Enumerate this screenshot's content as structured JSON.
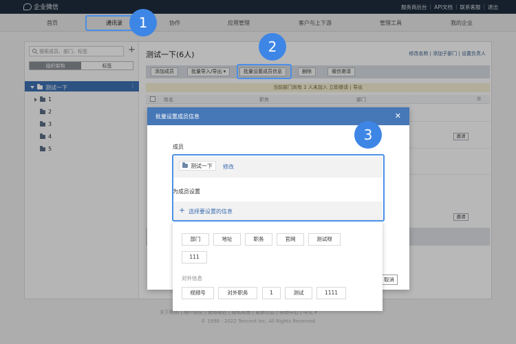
{
  "topbar": {
    "logo": "企业微信",
    "links": [
      "服务商后台",
      "API文档",
      "联系客服",
      "退出"
    ]
  },
  "nav": {
    "items": [
      "首页",
      "通讯录",
      "协作",
      "应用管理",
      "客户与上下游",
      "管理工具",
      "我的企业"
    ],
    "active": "通讯录"
  },
  "left": {
    "search_placeholder": "搜索成员、部门、标签",
    "plus": "+",
    "segments": [
      "组织架构",
      "标签"
    ],
    "root": "测试一下",
    "root_more": "⋮",
    "depts": [
      "1",
      "2",
      "3",
      "4",
      "5"
    ]
  },
  "main": {
    "title": "测试一下(6人)",
    "links": "修改名称 | 添加子部门 | 设置负责人",
    "toolbar": [
      "添加成员",
      "批量导入/导出 ▾",
      "批量设置成员信息",
      "删除",
      "微信邀请"
    ],
    "notice": "当前部门尚有 2 人未加入   立即邀请 | 导出",
    "columns": [
      "姓名",
      "职务",
      "部门"
    ],
    "invite": "邀请"
  },
  "modal": {
    "title": "批量设置成员信息",
    "close": "✕",
    "member_label": "成员",
    "member_chip": "测试一下",
    "member_edit": "修改",
    "settings_label": "为成员设置",
    "choose": "选择要设置的信息",
    "cancel": "取消"
  },
  "dropdown": {
    "basic": [
      "部门",
      "地址",
      "职务",
      "官网",
      "测试呀",
      "111"
    ],
    "external_label": "对外信息",
    "external": [
      "视频号",
      "对外职务",
      "1",
      "测试",
      "1111"
    ]
  },
  "footer": {
    "links": "关于腾讯 | 用户协议 | 使用规范 | 隐私政策 | 更新日志 | 帮助中心 | 中文 ▾",
    "copyright": "© 1998 - 2022 Tencent Inc. All Rights Reserved"
  },
  "annotations": {
    "badges": [
      "1",
      "2",
      "3"
    ]
  },
  "colors": {
    "accent": "#4677b6",
    "highlight": "#4a8fe8",
    "badge": "#3e86e6",
    "topbar": "#1f2d3d"
  }
}
